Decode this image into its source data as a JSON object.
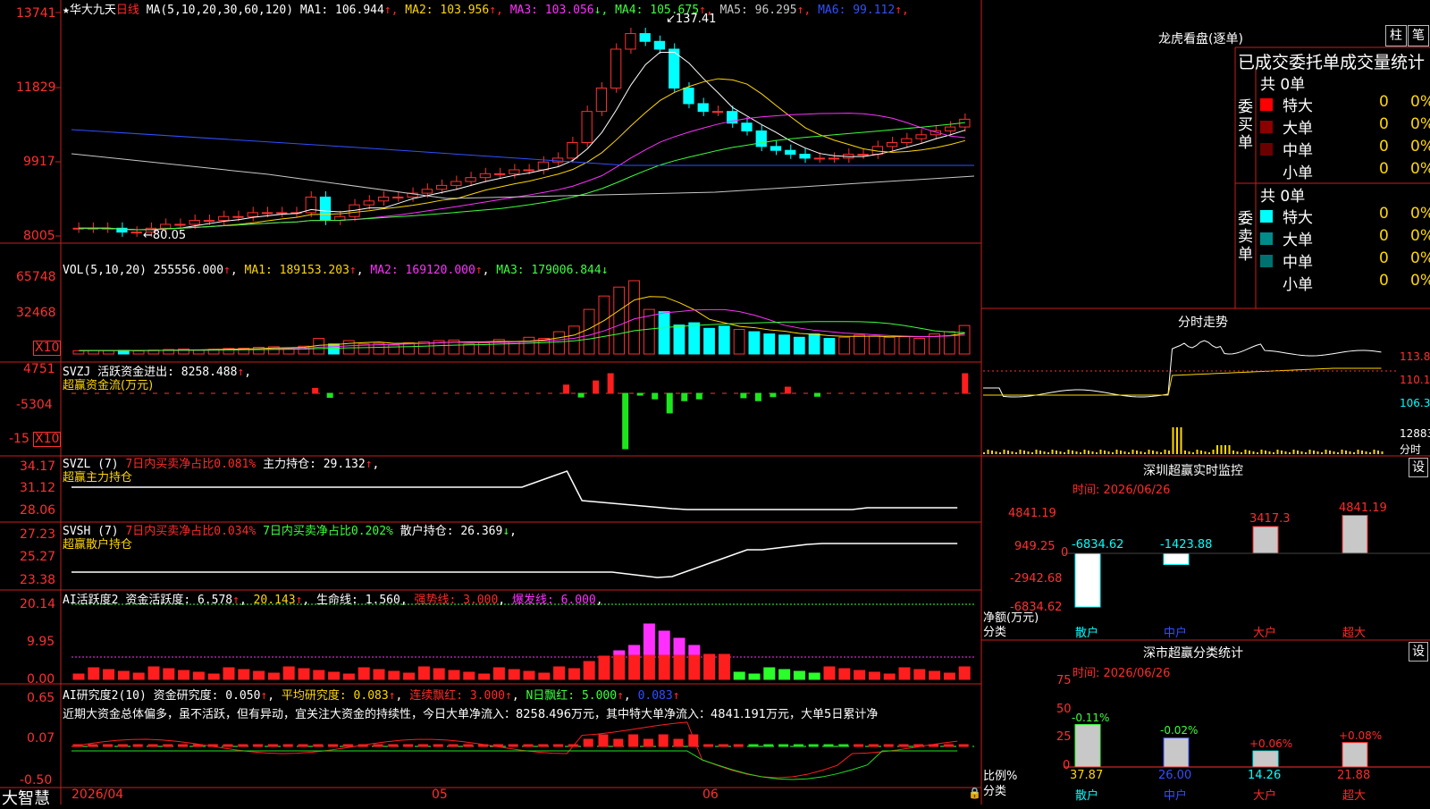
{
  "header": {
    "star": "★",
    "stock_name": "华大九天",
    "period": "日线",
    "ma_title": "MA(5,10,20,30,60,120)",
    "ma": [
      {
        "label": "MA1: 106.944",
        "arrow": "↑",
        "color": "#ffffff"
      },
      {
        "label": "MA2: 103.956",
        "arrow": "↑",
        "color": "#ffd700"
      },
      {
        "label": "MA3: 103.056",
        "arrow": "↓",
        "color": "#ff30ff"
      },
      {
        "label": "MA4: 105.675",
        "arrow": "↑",
        "color": "#3cff3c"
      },
      {
        "label": "MA5: 96.295",
        "arrow": "↑",
        "color": "#c8c8c8"
      },
      {
        "label": "MA6: 99.112",
        "arrow": "↑",
        "color": "#3050ff"
      }
    ]
  },
  "price_axis": [
    "13741",
    "11829",
    "9917",
    "8005"
  ],
  "price_marks": {
    "high": "137.41",
    "low": "80.05"
  },
  "vol_panel": {
    "title": "VOL(5,10,20)",
    "value": "255556.000",
    "ma1": "MA1: 189153.203",
    "ma2": "MA2: 169120.000",
    "ma3": "MA3: 179006.844",
    "axis": [
      "65748",
      "32468"
    ],
    "x10": "X10"
  },
  "svzj_panel": {
    "title": "SVZJ",
    "label": "活跃资金进出: 8258.488",
    "subtitle": "超赢资金流(万元)",
    "axis": [
      "4751",
      "-5304",
      "-15"
    ],
    "x10": "X10"
  },
  "svzl_panel": {
    "title": "SVZL (7)",
    "red_text": "7日内买卖净占比0.081%",
    "label": "主力持仓: 29.132",
    "subtitle": "超赢主力持仓",
    "axis": [
      "34.17",
      "31.12",
      "28.06"
    ]
  },
  "svsh_panel": {
    "title": "SVSH (7)",
    "red_text": "7日内买卖净占比0.034%",
    "green_text": "7日内买卖净占比0.202%",
    "label": "散户持仓: 26.369",
    "subtitle": "超赢散户持仓",
    "axis": [
      "27.23",
      "25.27",
      "23.38"
    ]
  },
  "ai_active_panel": {
    "title": "AI活跃度2",
    "label": "资金活跃度: 6.578",
    "val2": "20.143",
    "life": "生命线: 1.560",
    "strong": "强势线: 3.000",
    "burst": "爆发线: 6.000",
    "axis": [
      "20.14",
      "9.95",
      "0.00"
    ]
  },
  "ai_research_panel": {
    "title": "AI研究度2(10)",
    "label": "资金研究度: 0.050",
    "avg": "平均研究度: 0.083",
    "streak": "连续飘红: 3.000",
    "nday": "N日飘红: 5.000",
    "last": "0.083",
    "comment": "近期大资金总体偏多，虽不活跃，但有异动，宜关注大资金的持续性，今日大单净流入：8258.496万元，其中特大单净流入：4841.191万元，大单5日累计净",
    "axis": [
      "0.65",
      "0.07",
      "-0.50"
    ]
  },
  "bottom_bar": {
    "brand": "大智慧",
    "dates": [
      "2026/04",
      "05",
      "06"
    ]
  },
  "right_panel": {
    "dragon_title": "龙虎看盘(逐单)",
    "btn_col": "柱",
    "btn_pen": "笔",
    "table_title": "已成交委托单成交量统计",
    "buy_label": "委买单",
    "sell_label": "委卖单",
    "buy_total": "共 0单",
    "sell_total": "共 0单",
    "buy_rows": [
      {
        "name": "特大",
        "count": "0",
        "pct": "0%",
        "color": "#ff0000"
      },
      {
        "name": "大单",
        "count": "0",
        "pct": "0%",
        "color": "#8b0000"
      },
      {
        "name": "中单",
        "count": "0",
        "pct": "0%",
        "color": "#6b0000"
      },
      {
        "name": "小单",
        "count": "0",
        "pct": "0%",
        "color": ""
      }
    ],
    "sell_rows": [
      {
        "name": "特大",
        "count": "0",
        "pct": "0%",
        "color": "#00ffff"
      },
      {
        "name": "大单",
        "count": "0",
        "pct": "0%",
        "color": "#008b8b"
      },
      {
        "name": "中单",
        "count": "0",
        "pct": "0%",
        "color": "#007070"
      },
      {
        "name": "小单",
        "count": "0",
        "pct": "0%",
        "color": ""
      }
    ],
    "intraday_title": "分时走势",
    "intraday_axis": [
      "113.8",
      "110.1",
      "106.3",
      "12883",
      "分时"
    ],
    "sz_monitor_title": "深圳超赢实时监控",
    "sz_monitor_time": "时间: 2026/06/26",
    "sz_monitor_btn": "设",
    "sz_axis": [
      "4841.19",
      "949.25",
      "0",
      "-2942.68",
      "-6834.62"
    ],
    "sz_netflow_label": "净额(万元)",
    "sz_class_label": "分类",
    "sz_bars": [
      {
        "name": "散户",
        "value": "-6834.62"
      },
      {
        "name": "中户",
        "value": "-1423.88"
      },
      {
        "name": "大户",
        "value": "3417.3"
      },
      {
        "name": "超大",
        "value": "4841.19"
      }
    ],
    "sz_stats_title": "深市超赢分类统计",
    "sz_stats_time": "时间: 2026/06/26",
    "sz_stats_btn": "设",
    "stats_axis": [
      "75",
      "50",
      "25",
      "0"
    ],
    "stats_ratio_label": "比例%",
    "stats_class_label": "分类",
    "stats_bars": [
      {
        "name": "散户",
        "value": "37.87",
        "delta": "-0.11%"
      },
      {
        "name": "中户",
        "value": "26.00",
        "delta": "-0.02%"
      },
      {
        "name": "大户",
        "value": "14.26",
        "delta": "+0.06%"
      },
      {
        "name": "超大",
        "value": "21.88",
        "delta": "+0.08%"
      }
    ]
  },
  "chart_data": [
    {
      "type": "candlestick",
      "title": "华大九天 日线",
      "ylabel": "",
      "ylim": [
        80.05,
        137.41
      ],
      "series": [
        {
          "name": "price (approx close)",
          "values": [
            82,
            82,
            82,
            81,
            81,
            82,
            83,
            83,
            84,
            84,
            85,
            85,
            86,
            86,
            86,
            86,
            90,
            84,
            85,
            88,
            89,
            90,
            90,
            91,
            92,
            93,
            94,
            95,
            96,
            96,
            97,
            97,
            99,
            100,
            104,
            112,
            118,
            128,
            132,
            130,
            128,
            118,
            114,
            112,
            112,
            109,
            107,
            103,
            102,
            101,
            100,
            100,
            100,
            101,
            101,
            103,
            104,
            105,
            106,
            107,
            108,
            110
          ]
        }
      ],
      "note": "Main K-line chart with MA(5,10,20,30,60,120)"
    },
    {
      "type": "bar",
      "title": "VOL(5,10,20)",
      "series": [
        {
          "name": "volume",
          "values": [
            3000,
            3200,
            3100,
            3300,
            2800,
            3500,
            4000,
            4500,
            3600,
            4200,
            5000,
            5200,
            6000,
            6500,
            5400,
            7000,
            14000,
            9000,
            12000,
            9000,
            9500,
            8000,
            10000,
            11000,
            12000,
            12500,
            9000,
            10000,
            13000,
            11000,
            15000,
            14000,
            20000,
            25000,
            40000,
            52000,
            60000,
            65748,
            40000,
            38000,
            26000,
            28000,
            23000,
            25000,
            22000,
            20000,
            18000,
            17000,
            15000,
            18000,
            14000,
            15000,
            17000,
            16000,
            15000,
            15500,
            14000,
            18000,
            20000,
            25556
          ]
        }
      ]
    },
    {
      "type": "bar",
      "title": "SVZJ 超赢资金流(万元)",
      "series": [
        {
          "name": "活跃资金进出",
          "values": [
            0,
            0,
            0,
            0,
            0,
            0,
            0,
            0,
            0,
            0,
            0,
            0,
            0,
            0,
            0,
            0,
            1200,
            -1100,
            0,
            0,
            0,
            0,
            0,
            0,
            0,
            0,
            0,
            0,
            0,
            0,
            0,
            0,
            0,
            2000,
            -1000,
            3000,
            4751,
            -15000,
            -500,
            -1500,
            -5304,
            -2000,
            -1500,
            0,
            0,
            -1200,
            -2000,
            -900,
            1500,
            0,
            -800,
            0,
            0,
            0,
            0,
            0,
            0,
            0,
            0,
            0,
            8258
          ]
        }
      ]
    }
  ]
}
